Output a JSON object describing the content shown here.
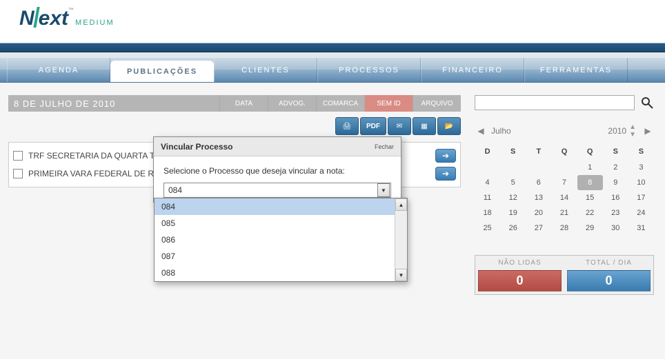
{
  "logo": {
    "brand": "Next",
    "sub": "MEDIUM"
  },
  "nav": {
    "items": [
      "AGENDA",
      "PUBLICAÇÕES",
      "CLIENTES",
      "PROCESSOS",
      "FINANCEIRO",
      "FERRAMENTAS"
    ],
    "active_index": 1
  },
  "title_bar": {
    "date": "8 DE JULHO DE 2010",
    "filters": [
      {
        "label": "DATA",
        "red": false
      },
      {
        "label": "ADVOG.",
        "red": false
      },
      {
        "label": "COMARCA",
        "red": false
      },
      {
        "label": "SEM ID",
        "red": true
      },
      {
        "label": "ARQUIVO",
        "red": false
      }
    ]
  },
  "actions": {
    "print": "🖨",
    "pdf": "PDF",
    "mail": "✉",
    "calc": "▦",
    "folder": "📁"
  },
  "list": {
    "rows": [
      "TRF SECRETARIA DA QUARTA T",
      "PRIMEIRA VARA FEDERAL DE RI"
    ]
  },
  "modal": {
    "title": "Vincular Processo",
    "close": "Fechar",
    "prompt": "Selecione o Processo que deseja vincular a nota:",
    "selected": "084",
    "options": [
      "084",
      "085",
      "086",
      "087",
      "088"
    ]
  },
  "search": {
    "placeholder": ""
  },
  "calendar": {
    "month": "Julho",
    "year": "2010",
    "dow": [
      "D",
      "S",
      "T",
      "Q",
      "Q",
      "S",
      "S"
    ],
    "weeks": [
      [
        "",
        "",
        "",
        "",
        "1",
        "2",
        "3"
      ],
      [
        "4",
        "5",
        "6",
        "7",
        "8",
        "9",
        "10"
      ],
      [
        "11",
        "12",
        "13",
        "14",
        "15",
        "16",
        "17"
      ],
      [
        "18",
        "19",
        "20",
        "21",
        "22",
        "23",
        "24"
      ],
      [
        "25",
        "26",
        "27",
        "28",
        "29",
        "30",
        "31"
      ]
    ],
    "selected": "8"
  },
  "totals": {
    "unread_label": "NÃO LIDAS",
    "unread_value": "0",
    "total_label": "TOTAL / DIA",
    "total_value": "0"
  }
}
